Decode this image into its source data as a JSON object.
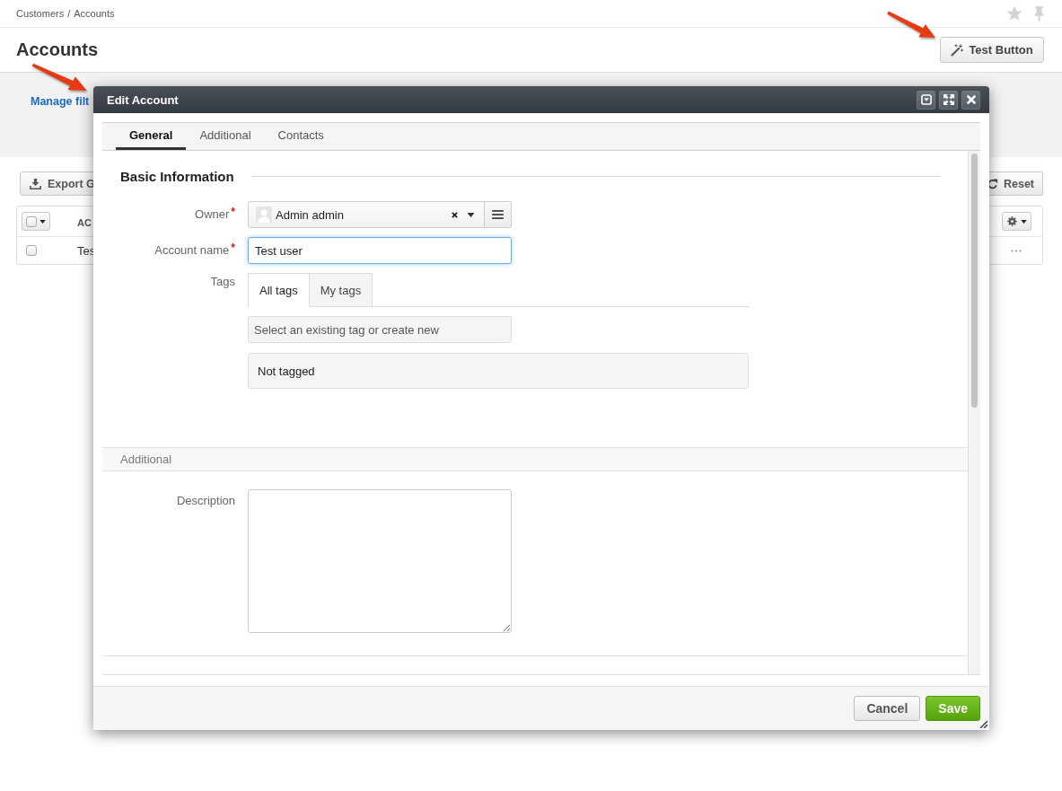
{
  "breadcrumb": {
    "items": [
      "Customers",
      "Accounts"
    ],
    "separator": "/"
  },
  "page_header": {
    "title": "Accounts",
    "action_button": "Test Button"
  },
  "filter_bar": {
    "manage_link": "Manage filt"
  },
  "toolbar": {
    "export_button": "Export G",
    "reset_button": "Reset"
  },
  "grid": {
    "select_all_checked": false,
    "columns": [
      "AC"
    ],
    "rows": [
      {
        "checked": false,
        "cells": [
          "Tes"
        ]
      }
    ]
  },
  "modal": {
    "title": "Edit Account",
    "tabs": [
      {
        "label": "General",
        "selected": true
      },
      {
        "label": "Additional",
        "selected": false
      },
      {
        "label": "Contacts",
        "selected": false
      }
    ],
    "sections": [
      {
        "kind": "titled",
        "title": "Basic Information",
        "fields": [
          {
            "kind": "select",
            "label": "Owner",
            "required_mark": "*",
            "value": "Admin admin",
            "focused": false
          },
          {
            "kind": "text",
            "label": "Account name",
            "required_mark": "*",
            "value": "Test user",
            "focused": true
          },
          {
            "kind": "tags",
            "label": "Tags",
            "focused": false,
            "tabs": [
              {
                "label": "All tags",
                "selected": true
              },
              {
                "label": "My tags",
                "selected": false
              }
            ],
            "placeholder": "Select an existing tag or create new",
            "empty_text": "Not tagged"
          }
        ]
      },
      {
        "kind": "band",
        "title": "Additional",
        "fields": [
          {
            "kind": "textarea",
            "label": "Description",
            "focused": false
          }
        ]
      }
    ],
    "buttons": [
      {
        "label": "Cancel",
        "kind": "secondary"
      },
      {
        "label": "Save",
        "kind": "primary"
      }
    ]
  }
}
